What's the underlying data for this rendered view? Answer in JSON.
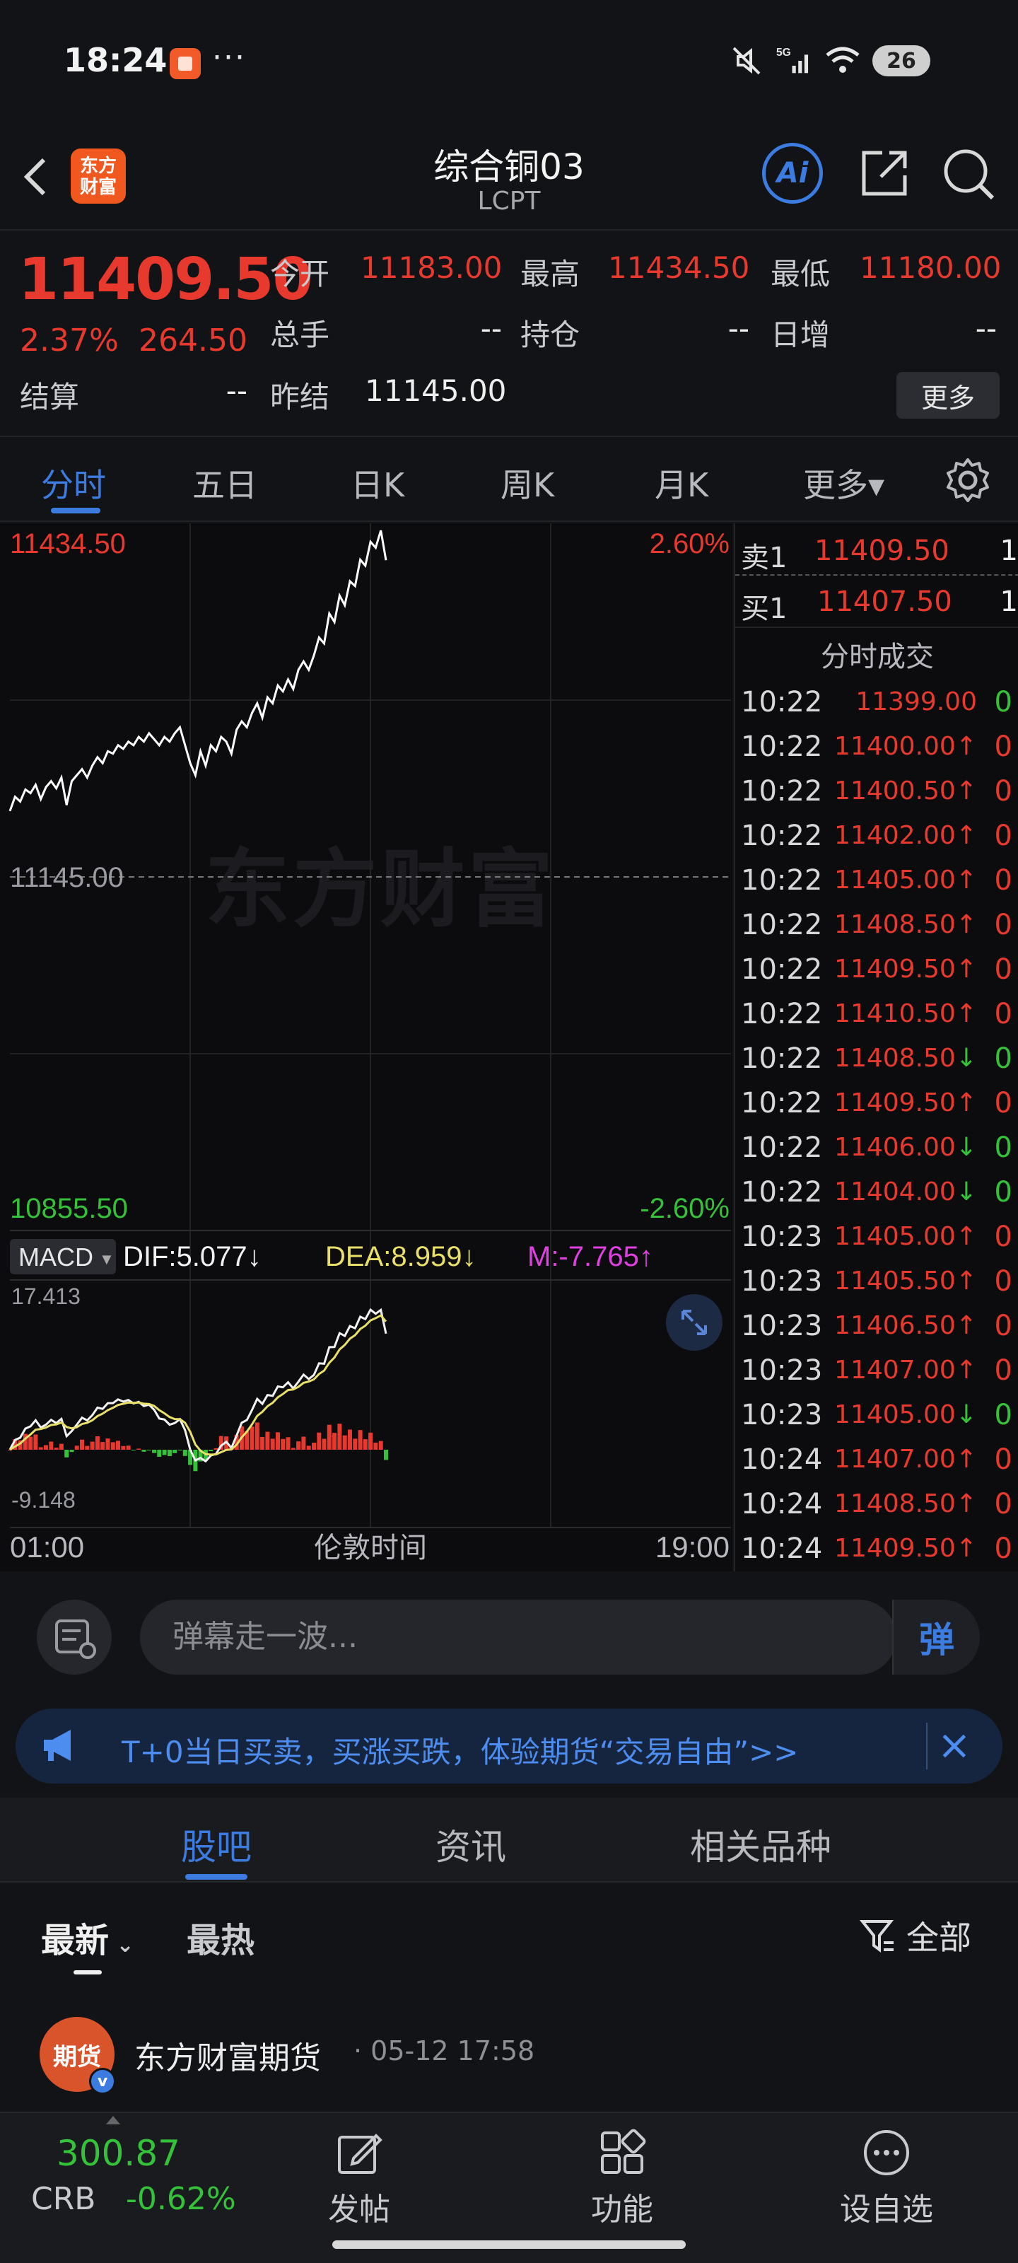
{
  "status_bar": {
    "time": "18:24",
    "dots": "···",
    "network": "5G",
    "battery": "26"
  },
  "header": {
    "logo_line1": "东方",
    "logo_line2": "财富",
    "title": "综合铜03",
    "subtitle": "LCPT",
    "ai_label": "Ai"
  },
  "quote": {
    "last_price": "11409.50",
    "change_pct": "2.37%",
    "change_amt": "264.50",
    "open_label": "今开",
    "open_value": "11183.00",
    "high_label": "最高",
    "high_value": "11434.50",
    "low_label": "最低",
    "low_value": "11180.00",
    "volume_label": "总手",
    "volume_value": "--",
    "oi_label": "持仓",
    "oi_value": "--",
    "daily_inc_label": "日增",
    "daily_inc_value": "--",
    "settle_label": "结算",
    "settle_value": "--",
    "prev_settle_label": "昨结",
    "prev_settle_value": "11145.00",
    "more_label": "更多"
  },
  "period_tabs": {
    "items": [
      "分时",
      "五日",
      "日K",
      "周K",
      "月K",
      "更多▾"
    ],
    "active_index": 0
  },
  "chart": {
    "max_label": "11434.50",
    "max_pct": "2.60%",
    "min_label": "10855.50",
    "min_pct": "-2.60%",
    "prev_settle_label": "11145.00",
    "watermark": "东方财富",
    "macd_label": "MACD",
    "dif": "DIF:5.077↓",
    "dea": "DEA:8.959↓",
    "m": "M:-7.765↑",
    "macd_max": "17.413",
    "macd_min": "-9.148",
    "time_start": "01:00",
    "time_mid": "伦敦时间",
    "time_end": "19:00",
    "colors": {
      "up": "#e8392f",
      "down": "#35c23a",
      "price_line": "#ffffff",
      "dea": "#e9e06a",
      "m": "#e040e0"
    }
  },
  "chart_data": {
    "type": "line",
    "title": "",
    "xlabel": "伦敦时间",
    "ylabel": "",
    "x_range": [
      "01:00",
      "19:00"
    ],
    "ylim": [
      10855.5,
      11434.5
    ],
    "reference_line": 11145.0,
    "series": [
      {
        "values": [
          11200,
          11212,
          11208,
          11218,
          11215,
          11222,
          11210,
          11220,
          11225,
          11219,
          11228,
          11205,
          11225,
          11230,
          11235,
          11228,
          11238,
          11245,
          11240,
          11250,
          11248,
          11255,
          11252,
          11258,
          11255,
          11262,
          11258,
          11265,
          11260,
          11255,
          11262,
          11258,
          11265,
          11270,
          11255,
          11240,
          11230,
          11250,
          11238,
          11255,
          11250,
          11262,
          11258,
          11248,
          11268,
          11275,
          11270,
          11282,
          11290,
          11278,
          11295,
          11290,
          11305,
          11300,
          11310,
          11302,
          11318,
          11325,
          11318,
          11330,
          11345,
          11340,
          11365,
          11358,
          11380,
          11372,
          11392,
          11388,
          11410,
          11405,
          11425,
          11420,
          11434.5,
          11409.5
        ]
      }
    ],
    "macd": {
      "dif": 5.077,
      "dea": 8.959,
      "m": -7.765,
      "ylim": [
        -9.148,
        17.413
      ]
    }
  },
  "orderbook": {
    "ask_label": "卖1",
    "ask_price": "11409.50",
    "ask_vol": "1",
    "bid_label": "买1",
    "bid_price": "11407.50",
    "bid_vol": "1",
    "trades_title": "分时成交"
  },
  "trades": [
    {
      "time": "10:22",
      "price": "11399.00",
      "arrow": "",
      "vol": "0",
      "dir": "down"
    },
    {
      "time": "10:22",
      "price": "11400.00",
      "arrow": "↑",
      "vol": "0",
      "dir": "up"
    },
    {
      "time": "10:22",
      "price": "11400.50",
      "arrow": "↑",
      "vol": "0",
      "dir": "up"
    },
    {
      "time": "10:22",
      "price": "11402.00",
      "arrow": "↑",
      "vol": "0",
      "dir": "up"
    },
    {
      "time": "10:22",
      "price": "11405.00",
      "arrow": "↑",
      "vol": "0",
      "dir": "up"
    },
    {
      "time": "10:22",
      "price": "11408.50",
      "arrow": "↑",
      "vol": "0",
      "dir": "up"
    },
    {
      "time": "10:22",
      "price": "11409.50",
      "arrow": "↑",
      "vol": "0",
      "dir": "up"
    },
    {
      "time": "10:22",
      "price": "11410.50",
      "arrow": "↑",
      "vol": "0",
      "dir": "up"
    },
    {
      "time": "10:22",
      "price": "11408.50",
      "arrow": "↓",
      "vol": "0",
      "dir": "down"
    },
    {
      "time": "10:22",
      "price": "11409.50",
      "arrow": "↑",
      "vol": "0",
      "dir": "up"
    },
    {
      "time": "10:22",
      "price": "11406.00",
      "arrow": "↓",
      "vol": "0",
      "dir": "down"
    },
    {
      "time": "10:22",
      "price": "11404.00",
      "arrow": "↓",
      "vol": "0",
      "dir": "down"
    },
    {
      "time": "10:23",
      "price": "11405.00",
      "arrow": "↑",
      "vol": "0",
      "dir": "up"
    },
    {
      "time": "10:23",
      "price": "11405.50",
      "arrow": "↑",
      "vol": "0",
      "dir": "up"
    },
    {
      "time": "10:23",
      "price": "11406.50",
      "arrow": "↑",
      "vol": "0",
      "dir": "up"
    },
    {
      "time": "10:23",
      "price": "11407.00",
      "arrow": "↑",
      "vol": "0",
      "dir": "up"
    },
    {
      "time": "10:23",
      "price": "11405.00",
      "arrow": "↓",
      "vol": "0",
      "dir": "down"
    },
    {
      "time": "10:24",
      "price": "11407.00",
      "arrow": "↑",
      "vol": "0",
      "dir": "up"
    },
    {
      "time": "10:24",
      "price": "11408.50",
      "arrow": "↑",
      "vol": "0",
      "dir": "up"
    },
    {
      "time": "10:24",
      "price": "11409.50",
      "arrow": "↑",
      "vol": "0",
      "dir": "up"
    }
  ],
  "danmu": {
    "placeholder": "弹幕走一波...",
    "send_label": "弹"
  },
  "promo": {
    "text": "T+0当日买卖，买涨买跌，体验期货“交易自由”>>"
  },
  "community_tabs": {
    "items": [
      "股吧",
      "资讯",
      "相关品种"
    ],
    "active_index": 0
  },
  "filter": {
    "latest": "最新",
    "hot": "最热",
    "all": "全部"
  },
  "post": {
    "avatar_text": "期货",
    "author": "东方财富期货",
    "time": "· 05-12 17:58"
  },
  "bottom_nav": {
    "crb_value": "300.87",
    "crb_label": "CRB",
    "crb_pct": "-0.62%",
    "post_label": "发帖",
    "function_label": "功能",
    "watchlist_label": "设自选"
  }
}
